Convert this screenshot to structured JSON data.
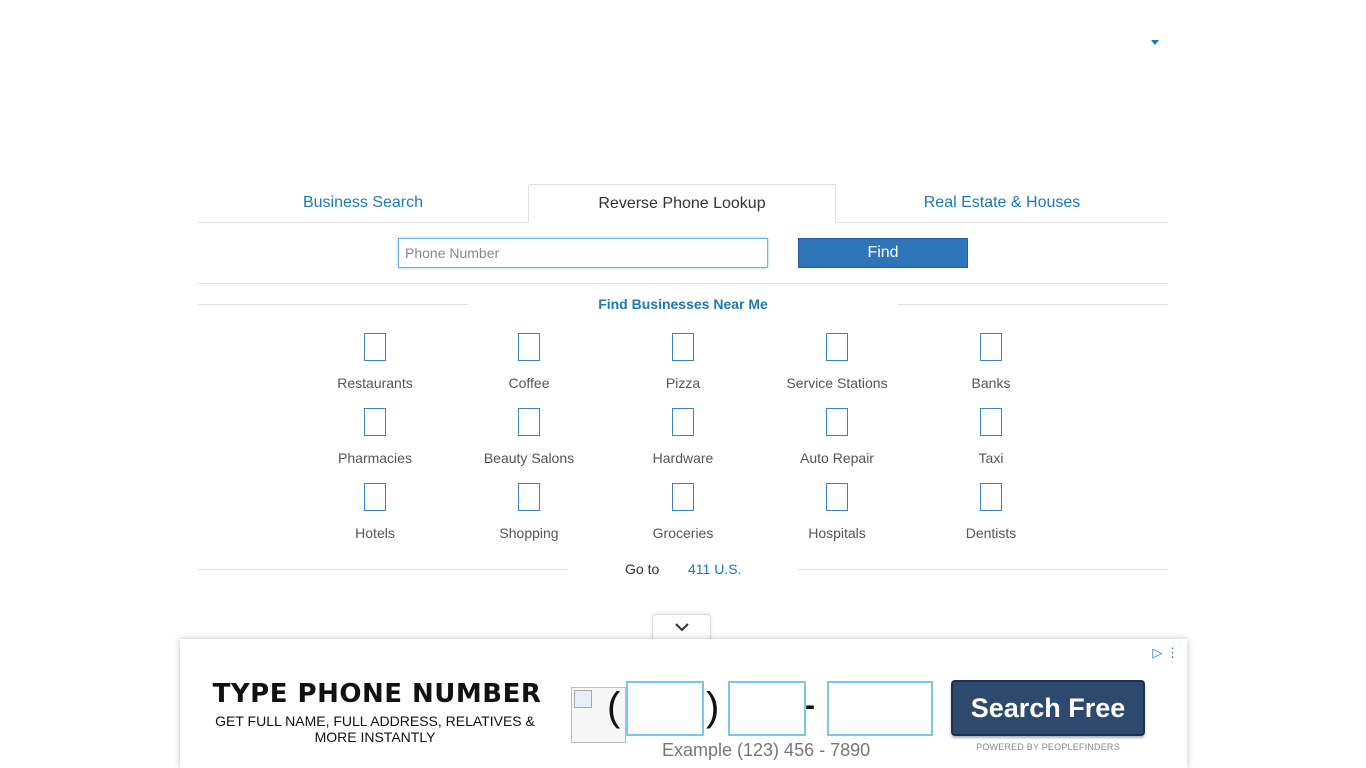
{
  "tabs": [
    {
      "label": "Business Search",
      "active": false
    },
    {
      "label": "Reverse Phone Lookup",
      "active": true
    },
    {
      "label": "Real Estate & Houses",
      "active": false
    }
  ],
  "search": {
    "placeholder": "Phone Number",
    "value": "",
    "button_label": "Find"
  },
  "near_me": {
    "title": "Find Businesses Near Me",
    "categories": [
      "Restaurants",
      "Coffee",
      "Pizza",
      "Service Stations",
      "Banks",
      "Pharmacies",
      "Beauty Salons",
      "Hardware",
      "Auto Repair",
      "Taxi",
      "Hotels",
      "Shopping",
      "Groceries",
      "Hospitals",
      "Dentists"
    ]
  },
  "goto": {
    "label": "Go to",
    "link": "411 U.S."
  },
  "ad": {
    "headline": "TYPE PHONE NUMBER",
    "subtext": "GET FULL NAME, FULL ADDRESS, RELATIVES & MORE INSTANTLY",
    "open_paren": "(",
    "close_paren": ")",
    "dash": "-",
    "example": "Example (123) 456 - 7890",
    "button_label": "Search Free",
    "powered_by": "POWERED BY PEOPLEFINDERS",
    "choices_icons": "▷ ⋮"
  },
  "colors": {
    "link": "#1a7ab8",
    "button": "#2e74b8",
    "ad_button": "#2d4a6e",
    "ad_field_border": "#7fc6e6"
  }
}
